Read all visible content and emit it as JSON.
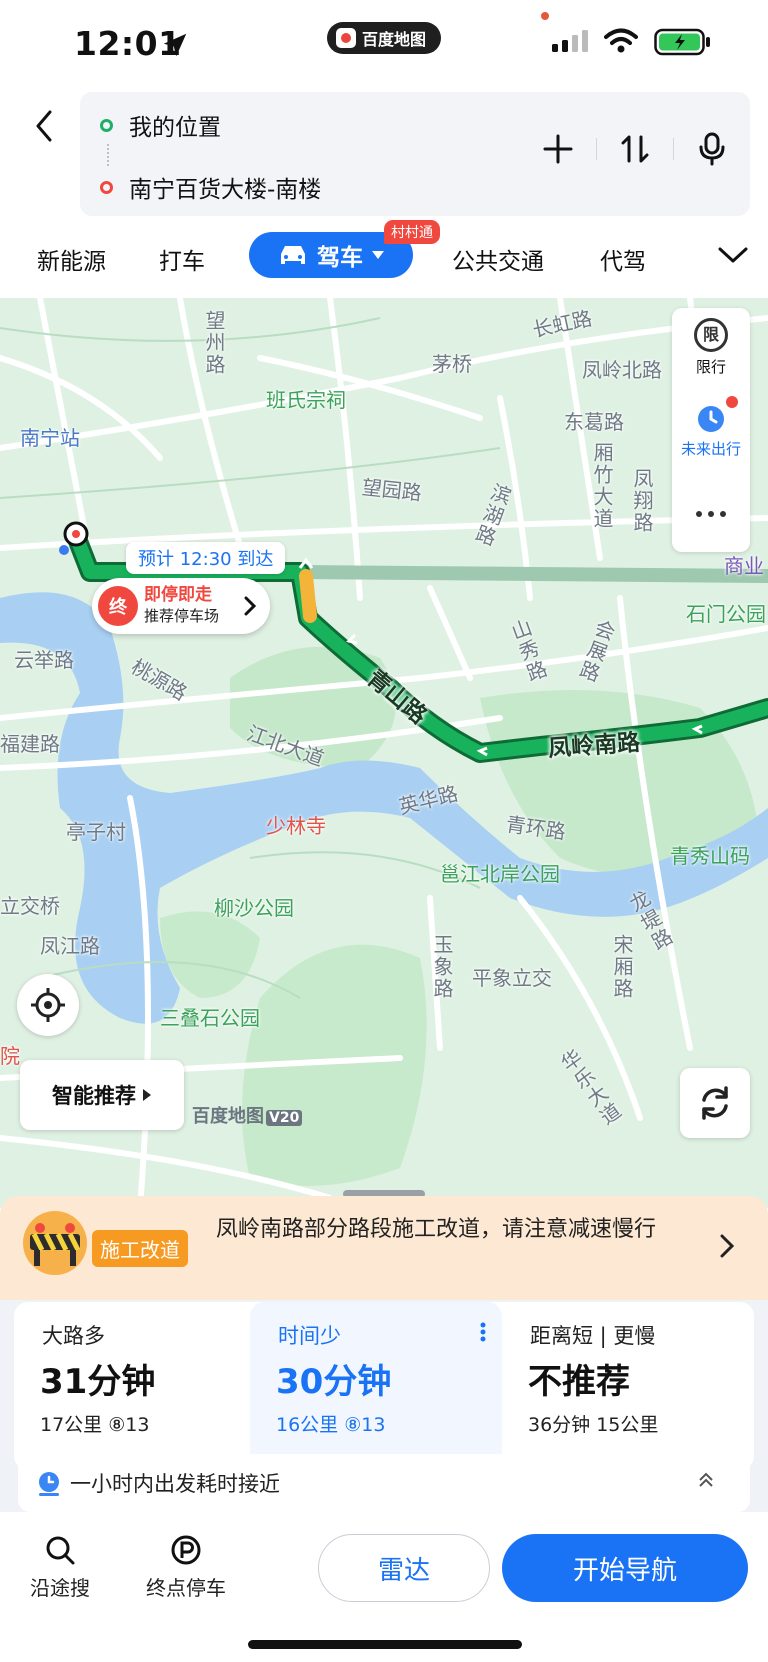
{
  "status": {
    "time": "12:01",
    "app_pill": "百度地图"
  },
  "route": {
    "origin": "我的位置",
    "destination": "南宁百货大楼-南楼"
  },
  "modes": {
    "items": [
      "新能源",
      "打车",
      "驾车",
      "公共交通",
      "代驾"
    ],
    "active": "驾车",
    "badge": "村村通"
  },
  "map": {
    "labels": {
      "wang_zhou_lu": "望州路",
      "changhong_lu": "长虹路",
      "maoqiao": "茅桥",
      "fengling_bei_lu": "凤岭北路",
      "banshi_zongci": "班氏宗祠",
      "nanning_zhan": "南宁站",
      "dongge_lu": "东葛路",
      "wangyuan_lu": "望园路",
      "binhu_lu": "滨湖路",
      "xiangzhu_dadao": "厢竹大道",
      "fengxiang_lu": "凤翔路",
      "shangye": "商业",
      "shimen_gongyuan": "石门公园",
      "shanxiu_lu": "山秀路",
      "huizhan_lu": "会展路",
      "yunju_lu": "云举路",
      "taoyuan_lu": "桃源路",
      "qingshan_lu": "青山路",
      "fengling_nan_lu": "凤岭南路",
      "fujian_lu": "福建路",
      "jiangbei_dadao": "江北大道",
      "yinghua_lu": "英华路",
      "tingzi_cun": "亭子村",
      "shaolin_si": "少林寺",
      "qinghuan_lu": "青环路",
      "qingxiu_shan": "青秀山码",
      "yongjiang_beian_gongyuan": "邕江北岸公园",
      "lijiao_qiao": "立交桥",
      "liusha_gongyuan": "柳沙公园",
      "longti_lu": "龙堤路",
      "fengjiang_lu": "凤江路",
      "yuxiang_lu": "玉象路",
      "pingxiang_lijiao": "平象立交",
      "songxiang_lu": "宋厢路",
      "sandieshi_gongyuan": "三叠石公园",
      "hospital": "院",
      "huale_dadao": "华乐大道"
    },
    "eta": "预计 12:30 到达",
    "end_icon": "终",
    "park_title": "即停即走",
    "park_sub": "推荐停车场",
    "side_limit_icon": "限",
    "side_limit": "限行",
    "side_future": "未来出行",
    "smart_recommend": "智能推荐",
    "watermark": "百度地图",
    "watermark_ver": "V20"
  },
  "notice": {
    "tag": "施工改道",
    "text": "凤岭南路部分路段施工改道，请注意减速慢行"
  },
  "options": [
    {
      "tag": "大路多",
      "time": "31分钟",
      "sub": "17公里 ⑧13",
      "selected": false
    },
    {
      "tag": "时间少",
      "time": "30分钟",
      "sub": "16公里 ⑧13",
      "selected": true
    },
    {
      "tag": "距离短 | 更慢",
      "time": "不推荐",
      "sub": "36分钟 15公里",
      "selected": false
    }
  ],
  "hint": "一小时内出发耗时接近",
  "actions": {
    "along_search": "沿途搜",
    "end_parking": "终点停车",
    "radar": "雷达",
    "start_nav": "开始导航"
  },
  "colors": {
    "accent": "#1a73f5",
    "route_green": "#19b25c",
    "route_slow": "#f4b43a",
    "end_red": "#f0483e",
    "notice_bg": "#fde9d3"
  }
}
